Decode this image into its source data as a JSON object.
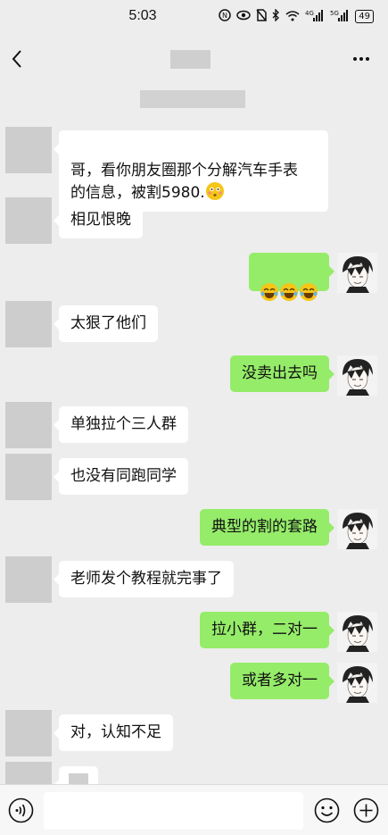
{
  "status_bar": {
    "time": "5:03",
    "icons": [
      "nfc-icon",
      "eye-icon",
      "no-sim-icon",
      "bluetooth-icon",
      "wifi-icon",
      "signal-4g-icon",
      "signal-5g-icon"
    ],
    "signal_1": "4G",
    "signal_2": "5G",
    "battery": "49"
  },
  "colors": {
    "background": "#ededed",
    "bubble_in": "#ffffff",
    "bubble_out": "#95ec69",
    "redacted": "#cdcdcd"
  },
  "messages": [
    {
      "side": "left",
      "text": "哥，看你朋友圈那个分解汽车手表\n的信息，被割5980.",
      "emoji": "flushed-emoji"
    },
    {
      "side": "left",
      "text": "相见恨晚"
    },
    {
      "side": "right",
      "text": "",
      "emoji": "tears-of-joy-emoji x3"
    },
    {
      "side": "left",
      "text": "太狠了他们"
    },
    {
      "side": "right",
      "text": "没卖出去吗"
    },
    {
      "side": "left",
      "text": "单独拉个三人群"
    },
    {
      "side": "left",
      "text": "也没有同跑同学"
    },
    {
      "side": "right",
      "text": "典型的割的套路"
    },
    {
      "side": "left",
      "text": "老师发个教程就完事了"
    },
    {
      "side": "right",
      "text": "拉小群，二对一"
    },
    {
      "side": "right",
      "text": "或者多对一"
    },
    {
      "side": "left",
      "text": "对，认知不足"
    },
    {
      "side": "left",
      "text": ""
    }
  ],
  "input_bar": {
    "placeholder": "",
    "icons": [
      "voice-icon",
      "emoji-icon",
      "plus-icon"
    ]
  }
}
